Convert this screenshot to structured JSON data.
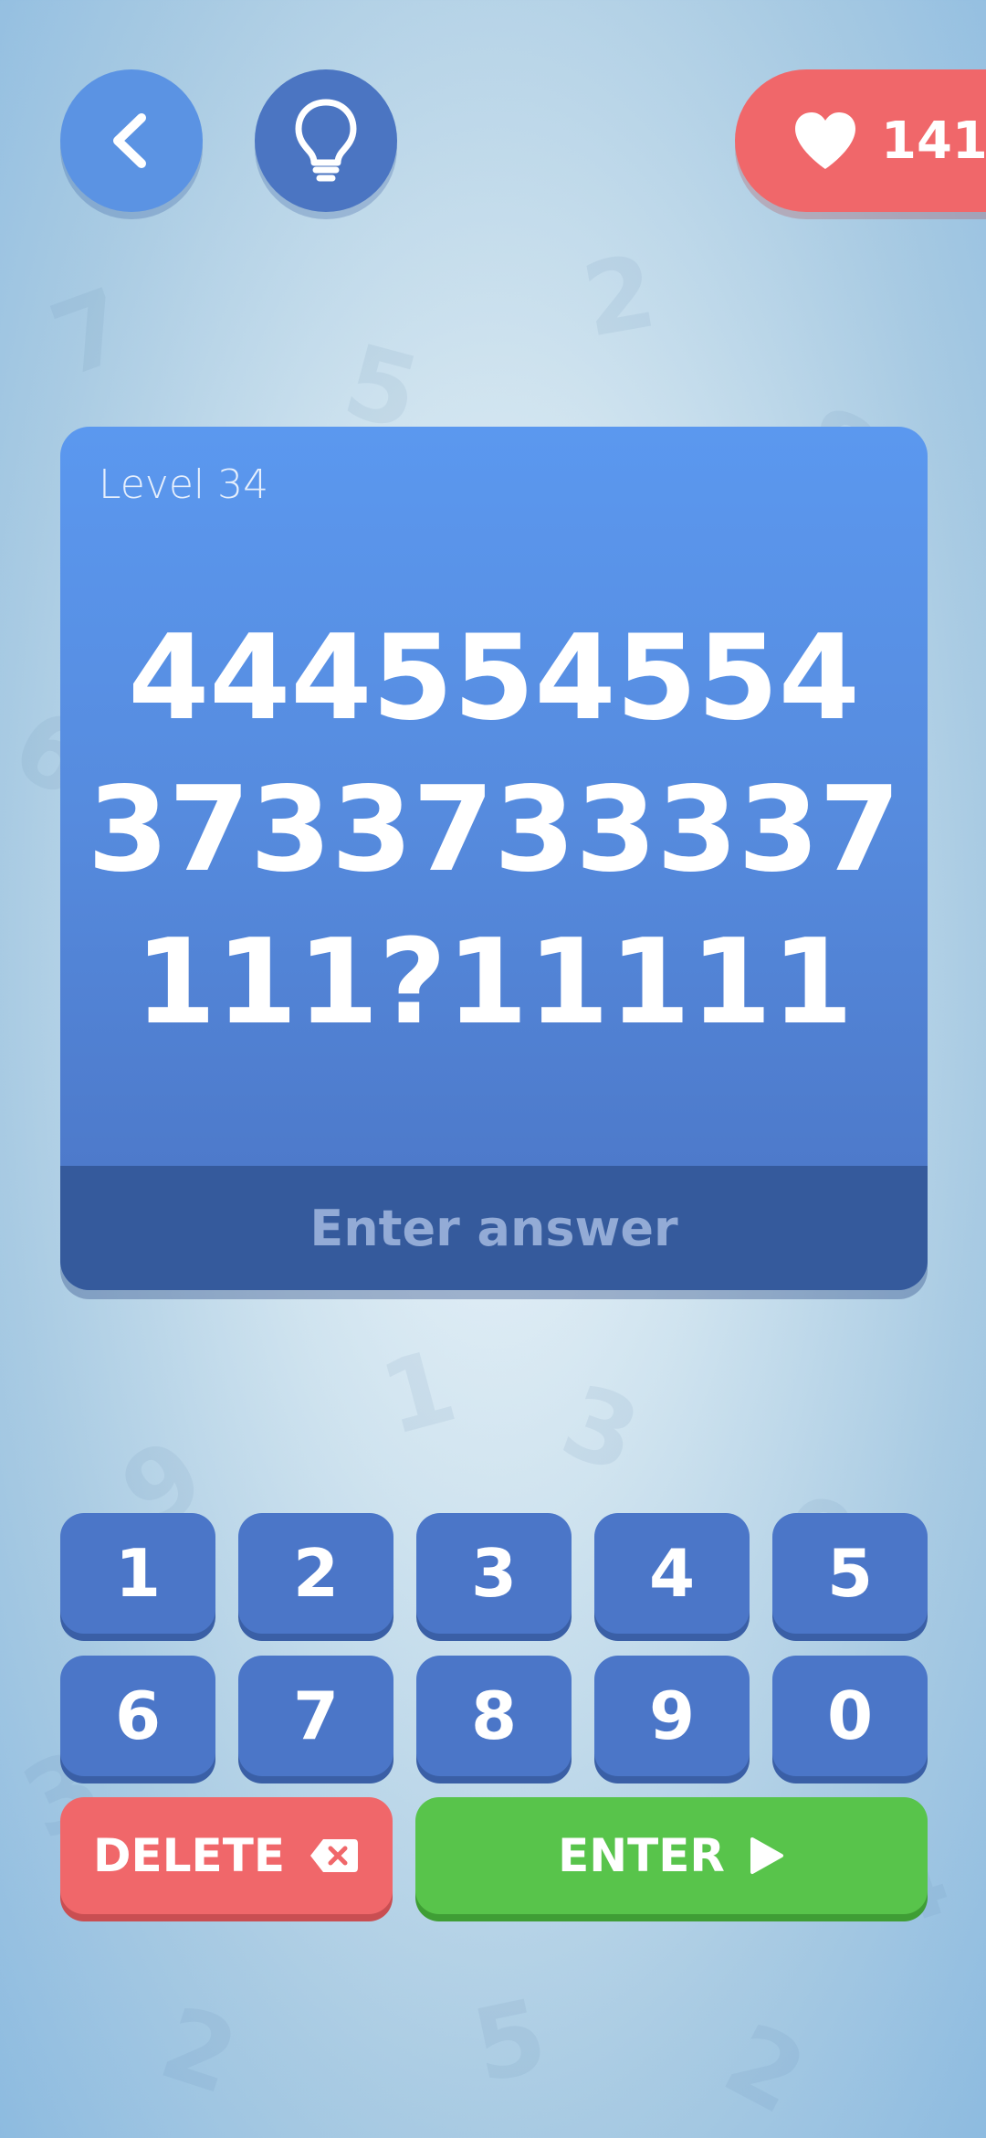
{
  "header": {
    "back_icon": "chevron-left-icon",
    "hint_icon": "lightbulb-icon",
    "lives_icon": "heart-icon",
    "lives_count": "141"
  },
  "puzzle": {
    "level_label": "Level 34",
    "lines": [
      "444554554",
      "3733733337",
      "111?11111"
    ],
    "answer_placeholder": "Enter answer"
  },
  "keypad": {
    "keys": [
      "1",
      "2",
      "3",
      "4",
      "5",
      "6",
      "7",
      "8",
      "9",
      "0"
    ],
    "delete_label": "DELETE",
    "enter_label": "ENTER"
  },
  "colors": {
    "accent_blue": "#4b76c8",
    "delete_red": "#f0676a",
    "enter_green": "#58c44b"
  }
}
